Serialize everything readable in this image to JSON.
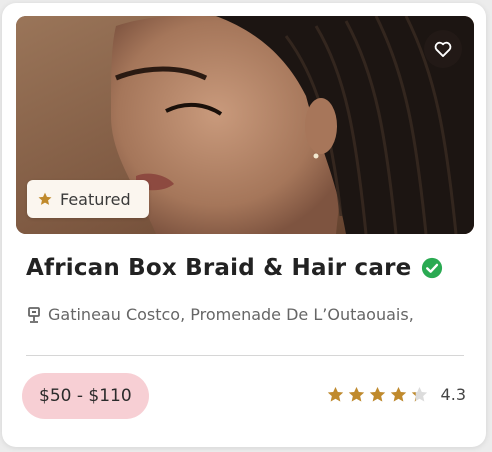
{
  "listing": {
    "badge_label": "Featured",
    "title": "African Box Braid & Hair care",
    "verified_icon": "check-circle-icon",
    "location": "Gatineau Costco, Promenade De L’Outaouais,",
    "location_icon": "map-pin-icon",
    "price_range": "$50 - $110",
    "rating_value": "4.3",
    "rating_fraction": 0.86,
    "favorite_icon": "heart-icon",
    "image_alt": "Woman with braided hair"
  },
  "colors": {
    "star": "#c08a2c",
    "verified": "#2aaa52",
    "price_badge_bg": "#f7cfd4"
  }
}
